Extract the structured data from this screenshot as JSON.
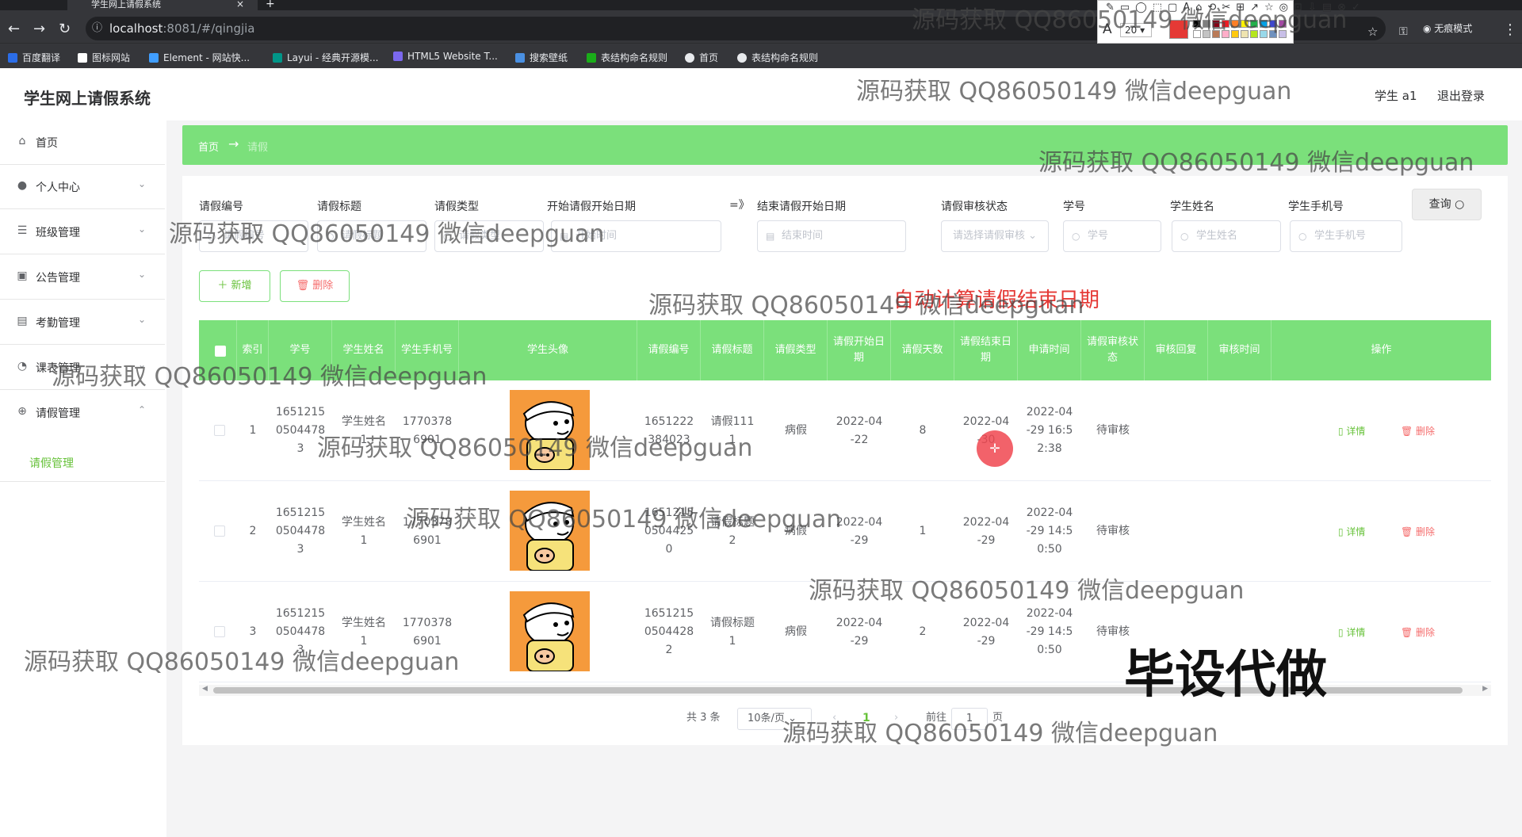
{
  "browser": {
    "tab_title": "学生网上请假系统",
    "url_host": "localhost",
    "url_path": ":8081/#/qingjia",
    "incognito_label": "无痕模式",
    "bookmarks": [
      {
        "label": "百度翻译",
        "color": "#2b6de8"
      },
      {
        "label": "图标网站",
        "color": "#ffffff"
      },
      {
        "label": "Element - 网站快...",
        "color": "#409eff"
      },
      {
        "label": "Layui - 经典开源模...",
        "color": "#009688"
      },
      {
        "label": "HTML5 Website T...",
        "color": "#7b68ee"
      },
      {
        "label": "搜索壁纸",
        "color": "#4a90e2"
      },
      {
        "label": "表结构命名规则",
        "color": "#1aad19"
      },
      {
        "label": "首页",
        "color": "#e8eaed"
      },
      {
        "label": "表结构命名规则",
        "color": "#e8eaed"
      }
    ]
  },
  "draw_toolbar": {
    "font_size": "20",
    "current_color": "#e53935",
    "swatches": [
      "#000000",
      "#7f7f7f",
      "#880015",
      "#ed1c24",
      "#ff7f27",
      "#fff200",
      "#22b14c",
      "#00a2e8",
      "#3f48cc",
      "#a349a4",
      "#ffffff",
      "#c3c3c3",
      "#b97a57",
      "#ffaec9",
      "#ffc90e",
      "#efe4b0",
      "#b5e61d",
      "#99d9ea",
      "#7092be",
      "#c8bfe7"
    ]
  },
  "app": {
    "title": "学生网上请假系统",
    "user": "学生 a1",
    "logout": "退出登录"
  },
  "sidebar": {
    "items": [
      {
        "label": "首页",
        "icon": "home-icon",
        "glyph": "⌂",
        "arrow": ""
      },
      {
        "label": "个人中心",
        "icon": "user-icon",
        "glyph": "👤",
        "arrow": "⌄"
      },
      {
        "label": "班级管理",
        "icon": "menu-icon",
        "glyph": "☰",
        "arrow": "⌄"
      },
      {
        "label": "公告管理",
        "icon": "notice-icon",
        "glyph": "▣",
        "arrow": "⌄"
      },
      {
        "label": "考勤管理",
        "icon": "attendance-icon",
        "glyph": "▤",
        "arrow": "⌄"
      },
      {
        "label": "课表管理",
        "icon": "clock-icon",
        "glyph": "◔",
        "arrow": "⌄"
      },
      {
        "label": "请假管理",
        "icon": "leave-icon",
        "glyph": "⊕",
        "arrow": "⌃"
      }
    ],
    "sub_item": "请假管理"
  },
  "breadcrumb": {
    "home": "首页",
    "separator": "→",
    "current": "请假"
  },
  "search": {
    "labels": [
      "请假编号",
      "请假标题",
      "请假类型",
      "开始请假开始日期",
      "结束请假开始日期",
      "请假审核状态",
      "学号",
      "学生姓名",
      "学生手机号"
    ],
    "range_separator": "=》",
    "placeholders": {
      "leave_no": "请假编号",
      "title": "请假标题",
      "type": "请假类型",
      "start": "开始时间",
      "end": "结束时间",
      "status": "请选择请假审核",
      "student_no": "学号",
      "student_name": "学生姓名",
      "phone": "学生手机号"
    },
    "query_button": "查询 ○"
  },
  "actions": {
    "add": "＋ 新增",
    "delete": "🗑 删除"
  },
  "annotation": "自动计算请假结束日期",
  "table": {
    "headers": [
      "索引",
      "学号",
      "学生姓名",
      "学生手机号",
      "学生头像",
      "请假编号",
      "请假标题",
      "请假类型",
      "请假开始日期",
      "请假天数",
      "请假结束日期",
      "申请时间",
      "请假审核状态",
      "审核回复",
      "审核时间",
      "操作"
    ],
    "rows": [
      {
        "index": "1",
        "student_no": "1651215\n0504478\n3",
        "name": "学生姓名\n1",
        "phone": "1770378\n6901",
        "leave_no": "1651222\n384023",
        "title": "请假111\n1",
        "type": "病假",
        "start": "2022-04\n-22",
        "days": "8",
        "end": "2022-04\n-30",
        "apply_time": "2022-04\n-29 16:5\n2:38",
        "status": "待审核",
        "reply": "",
        "audit_time": ""
      },
      {
        "index": "2",
        "student_no": "1651215\n0504478\n3",
        "name": "学生姓名\n1",
        "phone": "1770378\n6901",
        "leave_no": "1651215\n0504425\n0",
        "title": "请假标题\n2",
        "type": "病假",
        "start": "2022-04\n-29",
        "days": "1",
        "end": "2022-04\n-29",
        "apply_time": "2022-04\n-29 14:5\n0:50",
        "status": "待审核",
        "reply": "",
        "audit_time": ""
      },
      {
        "index": "3",
        "student_no": "1651215\n0504478\n3",
        "name": "学生姓名\n1",
        "phone": "1770378\n6901",
        "leave_no": "1651215\n0504428\n2",
        "title": "请假标题\n1",
        "type": "病假",
        "start": "2022-04\n-29",
        "days": "2",
        "end": "2022-04\n-29",
        "apply_time": "2022-04\n-29 14:5\n0:50",
        "status": "待审核",
        "reply": "",
        "audit_time": ""
      }
    ],
    "detail_label": "▯ 详情",
    "delete_label": "🗑 删除"
  },
  "pagination": {
    "total": "共 3 条",
    "page_size": "10条/页",
    "current_page": "1",
    "goto_label": "前往",
    "goto_value": "1",
    "page_suffix": "页"
  },
  "watermark": {
    "text": "源码获取 QQ86050149 微信deepguan",
    "big_text": "毕设代做"
  }
}
